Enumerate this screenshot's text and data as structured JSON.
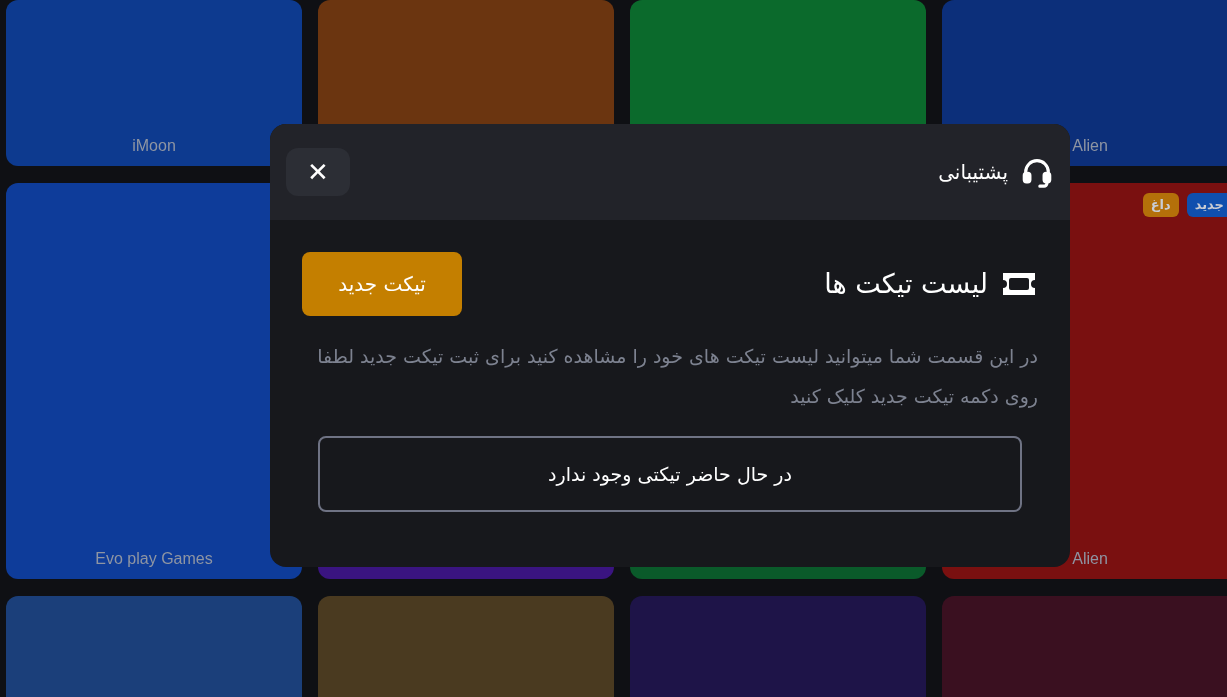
{
  "games": [
    {
      "provider": "Alien",
      "color": "#0c2f7a"
    },
    {
      "color": "#0b6a2c"
    },
    {
      "color": "#6b3510"
    },
    {
      "provider": "iMoon",
      "color": "#0d3a8f"
    },
    {
      "provider": "Alien",
      "color": "#7a1010",
      "badges": [
        {
          "label": "جدید",
          "color": "#0f4fae"
        },
        {
          "label": "داغ",
          "color": "#b4700a"
        }
      ]
    },
    {
      "color": "#0a5a2a"
    },
    {
      "color": "#3a1480"
    },
    {
      "provider": "Evo play Games",
      "color": "#0e3c9a"
    },
    {
      "color": "#3a1020"
    },
    {
      "color": "#1e1448"
    },
    {
      "color": "#4a3a20"
    },
    {
      "color": "#1b3f7a"
    }
  ],
  "modal": {
    "title": "پشتیبانی",
    "close": "✕",
    "heading": "لیست تیکت ها",
    "new_ticket": "تیکت جدید",
    "description": "در این قسمت شما میتوانید لیست تیکت های خود را مشاهده کنید برای ثبت تیکت جدید لطفا روی دکمه تیکت جدید کلیک کنید",
    "empty": "در حال حاضر تیکتی وجود ندارد"
  }
}
